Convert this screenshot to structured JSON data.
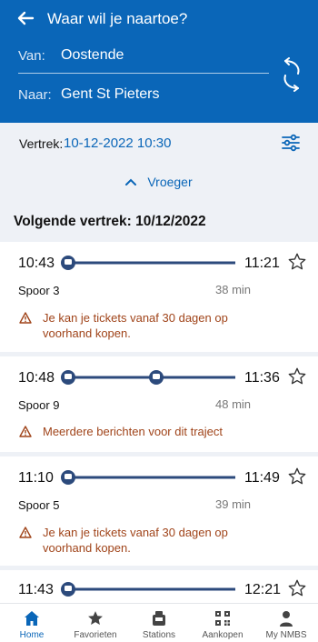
{
  "header": {
    "title": "Waar wil je naartoe?",
    "from_label": "Van:",
    "from_value": "Oostende",
    "to_label": "Naar:",
    "to_value": "Gent St Pieters"
  },
  "departure": {
    "label": "Vertrek:",
    "value": "10-12-2022 10:30"
  },
  "earlier_label": "Vroeger",
  "section_title": "Volgende vertrek: 10/12/2022",
  "trips": [
    {
      "dep": "10:43",
      "arr": "11:21",
      "platform": "Spoor 3",
      "duration": "38 min",
      "warning": "Je kan je tickets vanaf 30 dagen op voorhand kopen.",
      "transfers": 0
    },
    {
      "dep": "10:48",
      "arr": "11:36",
      "platform": "Spoor 9",
      "duration": "48 min",
      "warning": "Meerdere berichten voor dit traject",
      "transfers": 1
    },
    {
      "dep": "11:10",
      "arr": "11:49",
      "platform": "Spoor 5",
      "duration": "39 min",
      "warning": "Je kan je tickets vanaf 30 dagen op voorhand kopen.",
      "transfers": 0
    },
    {
      "dep": "11:43",
      "arr": "12:21",
      "transfers": 0
    }
  ],
  "nav": {
    "home": "Home",
    "favorites": "Favorieten",
    "stations": "Stations",
    "purchases": "Aankopen",
    "account": "My NMBS"
  },
  "colors": {
    "primary": "#0a66b8",
    "route_line": "#2c4a7c",
    "warning": "#a0441a"
  }
}
